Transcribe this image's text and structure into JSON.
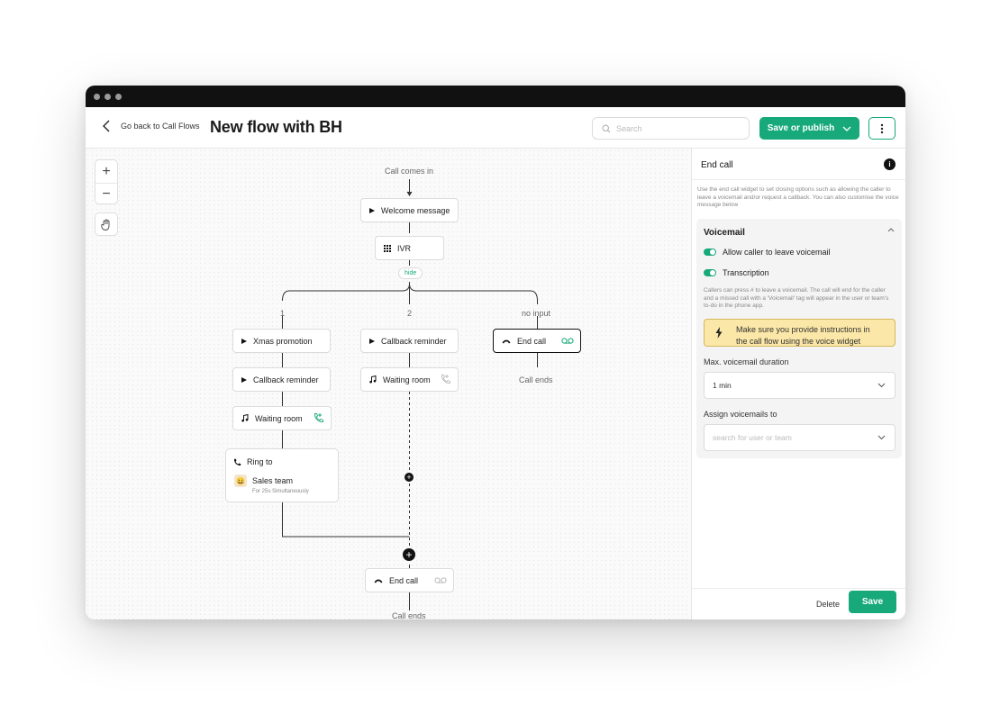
{
  "header": {
    "back_label": "Go back to Call Flows",
    "title": "New flow with BH",
    "search_placeholder": "Search",
    "save_publish_label": "Save or publish"
  },
  "canvas": {
    "zoom_in": "+",
    "zoom_out": "−",
    "start_label": "Call comes in",
    "welcome": "Welcome message",
    "ivr": "IVR",
    "hide": "hide",
    "branches": {
      "b1": "1",
      "b2": "2",
      "b3": "no input"
    },
    "col1": {
      "n1": "Xmas promotion",
      "n2": "Callback reminder",
      "n3": "Waiting room",
      "ring_title": "Ring to",
      "ring_team": "Sales team",
      "ring_sub": "For 25s Simultaneously",
      "avatar": "😀"
    },
    "col2": {
      "n1": "Callback reminder",
      "n2": "Waiting room"
    },
    "col3": {
      "end_call": "End call",
      "call_ends": "Call ends"
    },
    "bottom": {
      "end_call": "End call",
      "call_ends": "Call ends"
    }
  },
  "panel": {
    "title": "End call",
    "info": "i",
    "description": "Use the end call widget to set closing options such as allowing the caller to leave a voicemail and/or request a callback. You can also customise the voice message below",
    "voicemail_title": "Voicemail",
    "toggle1": "Allow caller to leave voicemail",
    "toggle2": "Transcription",
    "note": "Callers can press # to leave a voicemail. The call will end for the caller and a missed call with a 'Voicemail' tag will appear in the user or team's to-do in the phone app.",
    "warning_line1": "Make sure you provide instructions in",
    "warning_line2": "the call flow using the voice widget",
    "duration_label": "Max. voicemail duration",
    "duration_value": "1 min",
    "assign_label": "Assign voicemails to",
    "assign_placeholder": "search for user or team",
    "delete_label": "Delete",
    "save_label": "Save"
  },
  "colors": {
    "accent": "#18a97a",
    "warning_bg": "#fbe7a7"
  }
}
